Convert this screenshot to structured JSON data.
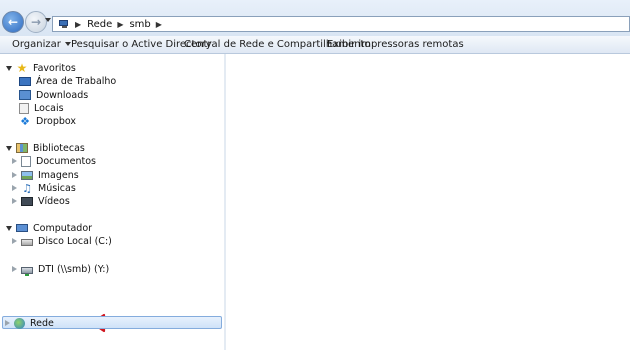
{
  "address_bar": {
    "breadcrumb": [
      "Rede",
      "smb"
    ]
  },
  "toolbar": {
    "items": [
      {
        "label": "Organizar",
        "has_dropdown": true
      },
      {
        "label": "Pesquisar o Active Directory"
      },
      {
        "label": "Central de Rede e Compartilhamento"
      },
      {
        "label": "Exibir impressoras remotas"
      }
    ]
  },
  "nav": {
    "favorites": {
      "label": "Favoritos",
      "expanded": true,
      "icon": "star-icon",
      "items": [
        {
          "label": "Área de Trabalho",
          "icon": "desktop-icon"
        },
        {
          "label": "Downloads",
          "icon": "downloads-icon"
        },
        {
          "label": "Locais",
          "icon": "recent-places-icon"
        },
        {
          "label": "Dropbox",
          "icon": "dropbox-icon"
        }
      ]
    },
    "libraries": {
      "label": "Bibliotecas",
      "expanded": true,
      "icon": "libraries-icon",
      "items": [
        {
          "label": "Documentos",
          "icon": "documents-icon"
        },
        {
          "label": "Imagens",
          "icon": "pictures-icon"
        },
        {
          "label": "Músicas",
          "icon": "music-icon"
        },
        {
          "label": "Vídeos",
          "icon": "videos-icon"
        }
      ]
    },
    "computer": {
      "label": "Computador",
      "expanded": true,
      "icon": "computer-icon",
      "items": [
        {
          "label": "Disco Local (C:)",
          "icon": "local-disk-icon"
        },
        {
          "label": "DTI (\\\\smb) (Y:)",
          "icon": "network-drive-icon"
        }
      ]
    },
    "network": {
      "label": "Rede",
      "icon": "network-icon",
      "selected": true
    }
  },
  "colors": {
    "annotation_arrow": "#d0161f",
    "selection": "#cfe2f8"
  }
}
